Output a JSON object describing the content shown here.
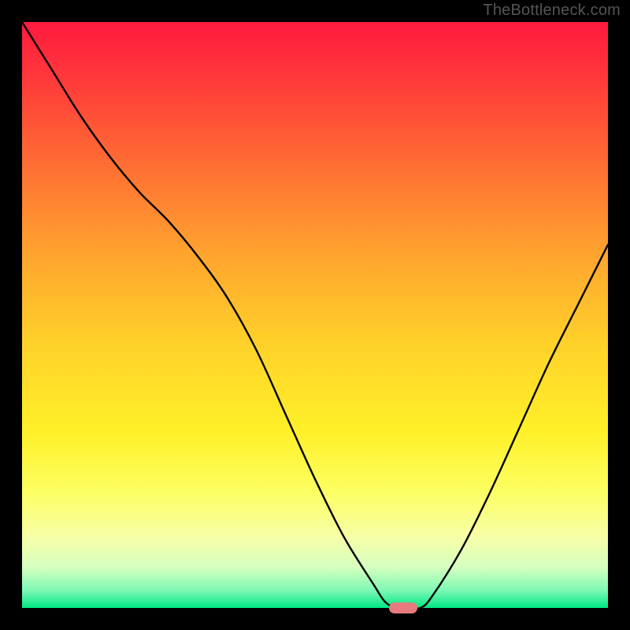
{
  "watermark": {
    "text": "TheBottleneck.com"
  },
  "chart_data": {
    "type": "line",
    "title": "",
    "xlabel": "",
    "ylabel": "",
    "xlim": [
      0,
      100
    ],
    "ylim": [
      0,
      100
    ],
    "grid": false,
    "legend": false,
    "series": [
      {
        "name": "bottleneck-curve",
        "x": [
          0,
          5,
          10,
          15,
          20,
          25,
          30,
          35,
          40,
          45,
          50,
          55,
          60,
          62,
          64,
          66,
          68,
          70,
          75,
          80,
          85,
          90,
          95,
          100
        ],
        "values": [
          100,
          92,
          84,
          77,
          71,
          66,
          60,
          53,
          44,
          33,
          22,
          12,
          4,
          1,
          0,
          0,
          0,
          2,
          10,
          20,
          31,
          42,
          52,
          62
        ]
      }
    ],
    "marker": {
      "x": 65,
      "y": 0,
      "color": "#e77a7e"
    },
    "gradient_stops": [
      {
        "offset": 0.0,
        "color": "#ff1a3e"
      },
      {
        "offset": 0.1,
        "color": "#ff3a3a"
      },
      {
        "offset": 0.25,
        "color": "#ff7033"
      },
      {
        "offset": 0.4,
        "color": "#ffa52e"
      },
      {
        "offset": 0.55,
        "color": "#ffd22a"
      },
      {
        "offset": 0.7,
        "color": "#fff028"
      },
      {
        "offset": 0.8,
        "color": "#fdff62"
      },
      {
        "offset": 0.88,
        "color": "#f6ffa8"
      },
      {
        "offset": 0.93,
        "color": "#d6ffbf"
      },
      {
        "offset": 0.97,
        "color": "#7ef8b5"
      },
      {
        "offset": 1.0,
        "color": "#00e884"
      }
    ]
  }
}
